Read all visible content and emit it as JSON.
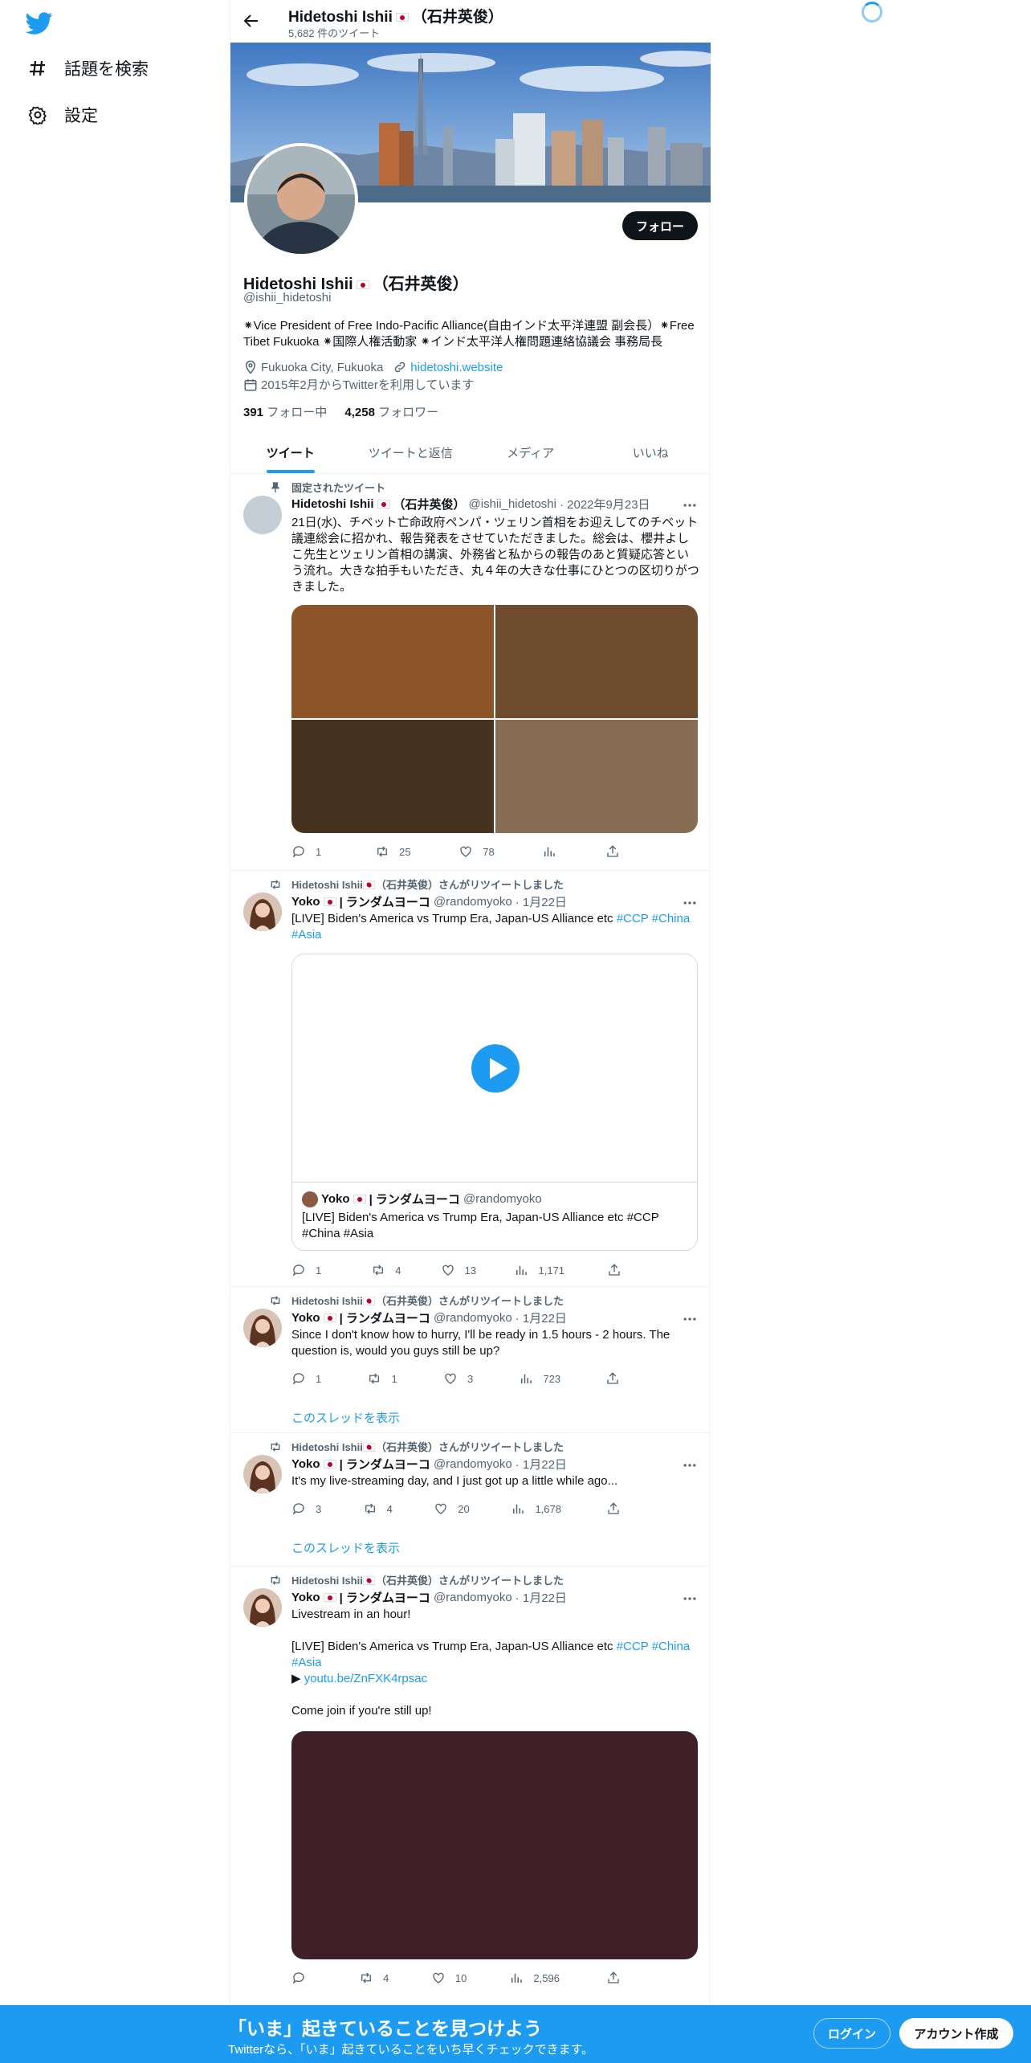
{
  "nav": {
    "explore_label": "話題を検索",
    "settings_label": "設定"
  },
  "header": {
    "name": "Hidetoshi Ishii",
    "name_suffix": "（石井英俊）",
    "tweet_count": "5,682 件のツイート"
  },
  "profile": {
    "name": "Hidetoshi Ishii",
    "name_suffix": "（石井英俊）",
    "handle": "@ishii_hidetoshi",
    "bio": "⁕Vice President of Free Indo-Pacific Alliance(自由インド太平洋連盟 副会長）⁕Free Tibet Fukuoka ⁕国際人権活動家 ⁕インド太平洋人権問題連絡協議会 事務局長",
    "location": "Fukuoka City, Fukuoka",
    "website": "hidetoshi.website",
    "joined": "2015年2月からTwitterを利用しています",
    "following_count": "391",
    "following_label": "フォロー中",
    "followers_count": "4,258",
    "followers_label": "フォロワー",
    "follow_button": "フォロー"
  },
  "tabs": [
    "ツイート",
    "ツイートと返信",
    "メディア",
    "いいね"
  ],
  "tweets": [
    {
      "social": "固定されたツイート",
      "name": "Hidetoshi Ishii",
      "name_suffix": "（石井英俊）",
      "handle": "@ishii_hidetoshi",
      "date": "· 2022年9月23日",
      "text": "21日(水)、チベット亡命政府ペンパ・ツェリン首相をお迎えしてのチベット議連総会に招かれ、報告発表をさせていただきました。総会は、櫻井よしこ先生とツェリン首相の講演、外務省と私からの報告のあと質疑応答という流れ。大きな拍手もいただき、丸４年の大きな仕事にひとつの区切りがつきました。",
      "replies": "1",
      "retweets": "25",
      "likes": "78",
      "views": ""
    },
    {
      "social": "Hidetoshi Ishii🇯🇵（石井英俊）さんがリツイートしました",
      "name": "Yoko",
      "name_suffix": "| ランダムヨーコ",
      "handle": "@randomyoko",
      "date": "· 1月22日",
      "text_plain": "[LIVE] Biden's America vs Trump Era, Japan-US Alliance etc ",
      "tags": [
        "#CCP",
        "#China",
        "#Asia"
      ],
      "card_name": "Yoko",
      "card_name_suffix": "| ランダムヨーコ",
      "card_handle": "@randomyoko",
      "card_text": "[LIVE] Biden's America vs Trump Era, Japan-US Alliance etc #CCP #China #Asia",
      "replies": "1",
      "retweets": "4",
      "likes": "13",
      "views": "1,171"
    },
    {
      "social": "Hidetoshi Ishii🇯🇵（石井英俊）さんがリツイートしました",
      "name": "Yoko",
      "name_suffix": "| ランダムヨーコ",
      "handle": "@randomyoko",
      "date": "· 1月22日",
      "text": "Since I don't know how to hurry, I'll be ready in 1.5 hours - 2 hours. The question is, would you guys still be up?",
      "replies": "1",
      "retweets": "1",
      "likes": "3",
      "views": "723",
      "show_thread": "このスレッドを表示"
    },
    {
      "social": "Hidetoshi Ishii🇯🇵（石井英俊）さんがリツイートしました",
      "name": "Yoko",
      "name_suffix": "| ランダムヨーコ",
      "handle": "@randomyoko",
      "date": "· 1月22日",
      "text": "It's my live-streaming day, and I just got up a little while ago...",
      "replies": "3",
      "retweets": "4",
      "likes": "20",
      "views": "1,678",
      "show_thread": "このスレッドを表示"
    },
    {
      "social": "Hidetoshi Ishii🇯🇵（石井英俊）さんがリツイートしました",
      "name": "Yoko",
      "name_suffix": "| ランダムヨーコ",
      "handle": "@randomyoko",
      "date": "· 1月22日",
      "line1": "Livestream in an hour!",
      "line2": "[LIVE] Biden's America vs Trump Era, Japan-US Alliance etc ",
      "tags": [
        "#CCP",
        "#China",
        "#Asia"
      ],
      "link": "youtu.be/ZnFXK4rpsac",
      "line3": "Come join if you're still up!",
      "replies": "",
      "retweets": "4",
      "likes": "10",
      "views": "2,596"
    }
  ],
  "bottom_bar": {
    "title": "「いま」起きていることを見つけよう",
    "subtitle": "Twitterなら、「いま」起きていることをいち早くチェックできます。",
    "login": "ログイン",
    "signup": "アカウント作成"
  },
  "colors": {
    "accent": "#1d9bf0",
    "text": "#0f1419",
    "muted": "#536471"
  }
}
